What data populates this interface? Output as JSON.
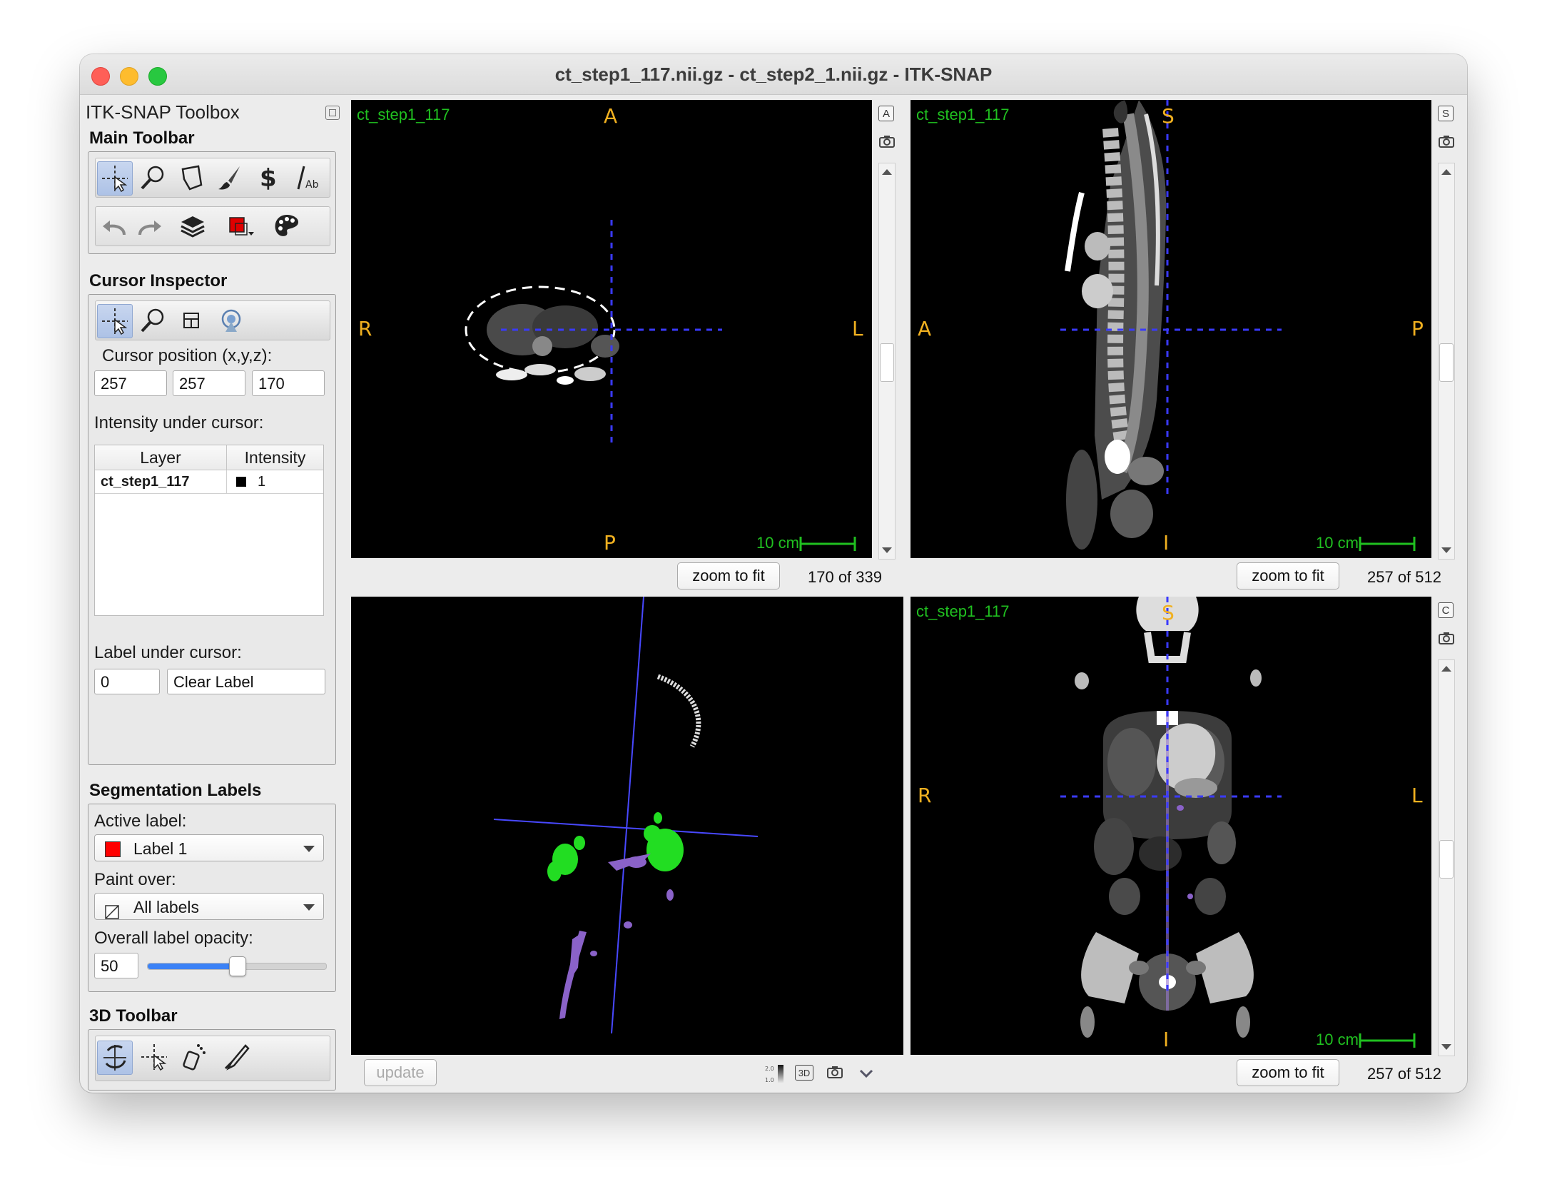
{
  "window": {
    "title": "ct_step1_117.nii.gz - ct_step2_1.nii.gz - ITK-SNAP"
  },
  "toolbox": {
    "title": "ITK-SNAP Toolbox",
    "main_toolbar": {
      "title": "Main Toolbar",
      "tools_row1": [
        "crosshair-tool-icon",
        "zoom-tool-icon",
        "polygon-tool-icon",
        "paintbrush-tool-icon",
        "snake-tool-icon",
        "annotation-tool-icon"
      ],
      "tools_row2": [
        "undo-icon",
        "redo-icon",
        "layers-icon",
        "label-color-icon",
        "palette-icon"
      ]
    },
    "cursor_inspector": {
      "title": "Cursor Inspector",
      "position_label": "Cursor position (x,y,z):",
      "x": "257",
      "y": "257",
      "z": "170",
      "intensity_label": "Intensity under cursor:",
      "table": {
        "headers": [
          "Layer",
          "Intensity"
        ],
        "rows": [
          {
            "layer": "ct_step1_117",
            "intensity": "1"
          }
        ]
      },
      "label_under_label": "Label under cursor:",
      "label_value": "0",
      "label_name": "Clear Label"
    },
    "segmentation_labels": {
      "title": "Segmentation Labels",
      "active_label_caption": "Active label:",
      "active_label": "Label 1",
      "active_label_color": "#ff0000",
      "paint_over_caption": "Paint over:",
      "paint_over": "All labels",
      "opacity_caption": "Overall label opacity:",
      "opacity_value": "50",
      "opacity_fraction": 0.5
    },
    "toolbar_3d": {
      "title": "3D Toolbar"
    }
  },
  "views": {
    "axial": {
      "layer": "ct_step1_117",
      "top": "A",
      "bottom": "P",
      "left": "R",
      "right": "L",
      "scale": "10 cm",
      "zoom": "zoom to fit",
      "slice": "170 of 339",
      "mode_letter": "A"
    },
    "sagittal": {
      "layer": "ct_step1_117",
      "top": "S",
      "bottom": "I",
      "left": "A",
      "right": "P",
      "scale": "10 cm",
      "zoom": "zoom to fit",
      "slice": "257 of 512",
      "mode_letter": "S"
    },
    "render3d": {
      "update": "update"
    },
    "coronal": {
      "layer": "ct_step1_117",
      "top": "S",
      "bottom": "I",
      "left": "R",
      "right": "L",
      "scale": "10 cm",
      "zoom": "zoom to fit",
      "slice": "257 of 512",
      "mode_letter": "C"
    }
  },
  "colors": {
    "orientation": "#f0b020",
    "layer_label": "#20c020",
    "crosshair": "#3a3aff",
    "seg_green": "#22dd22",
    "seg_purple": "#8a62c8"
  }
}
